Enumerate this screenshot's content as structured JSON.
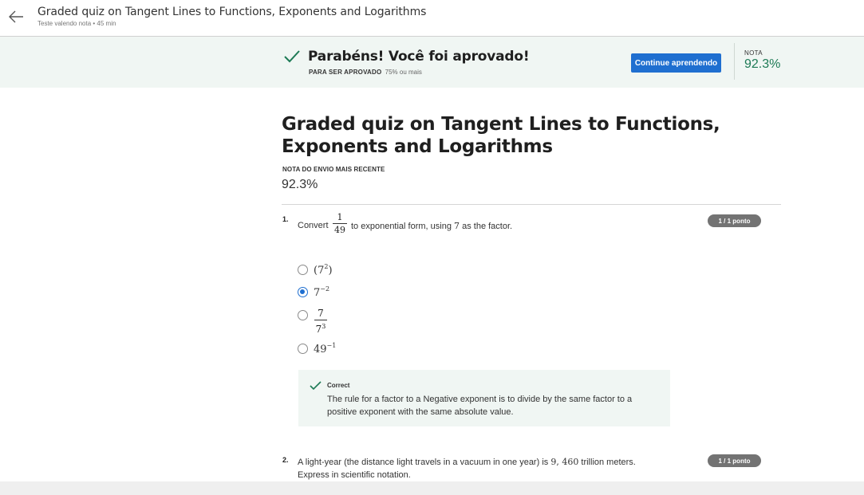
{
  "header": {
    "title": "Graded quiz on Tangent Lines to Functions, Exponents and Logarithms",
    "subtitle": "Teste valendo nota • 45 min"
  },
  "banner": {
    "title": "Parabéns! Você foi aprovado!",
    "requirement_label": "PARA SER APROVADO",
    "requirement_value": "75% ou mais",
    "continue_label": "Continue aprendendo",
    "grade_label": "NOTA",
    "grade_value": "92.3%",
    "accent_color": "#1f6fd0",
    "success_color": "#1d7a55"
  },
  "main": {
    "title": "Graded quiz on Tangent Lines to Functions, Exponents and Logarithms",
    "recent_label": "NOTA DO ENVIO MAIS RECENTE",
    "recent_value": "92.3%"
  },
  "questions": [
    {
      "number": "1.",
      "prefix": "Convert",
      "fraction_num": "1",
      "fraction_den": "49",
      "suffix": "to exponential form, using",
      "factor": "7",
      "suffix2": "as the factor.",
      "badge": "1 / 1 ponto",
      "options": [
        {
          "base": "(7",
          "exp": "2",
          "close": ")",
          "selected": false
        },
        {
          "base": "7",
          "exp": "−2",
          "close": "",
          "selected": true
        },
        {
          "frac_num": "7",
          "frac_den_base": "7",
          "frac_den_exp": "3",
          "selected": false
        },
        {
          "base": "49",
          "exp": "−1",
          "close": "",
          "selected": false
        }
      ],
      "feedback": {
        "title": "Correct",
        "text": "The rule for a factor to a Negative exponent is to divide by the same factor to a positive exponent with the same absolute value."
      }
    },
    {
      "number": "2.",
      "text_a": "A light-year (the distance light travels in a vacuum in one year) is",
      "value": "9, 460",
      "text_b": "trillion meters.",
      "text_c": "Express in scientific notation.",
      "badge": "1 / 1 ponto"
    }
  ]
}
